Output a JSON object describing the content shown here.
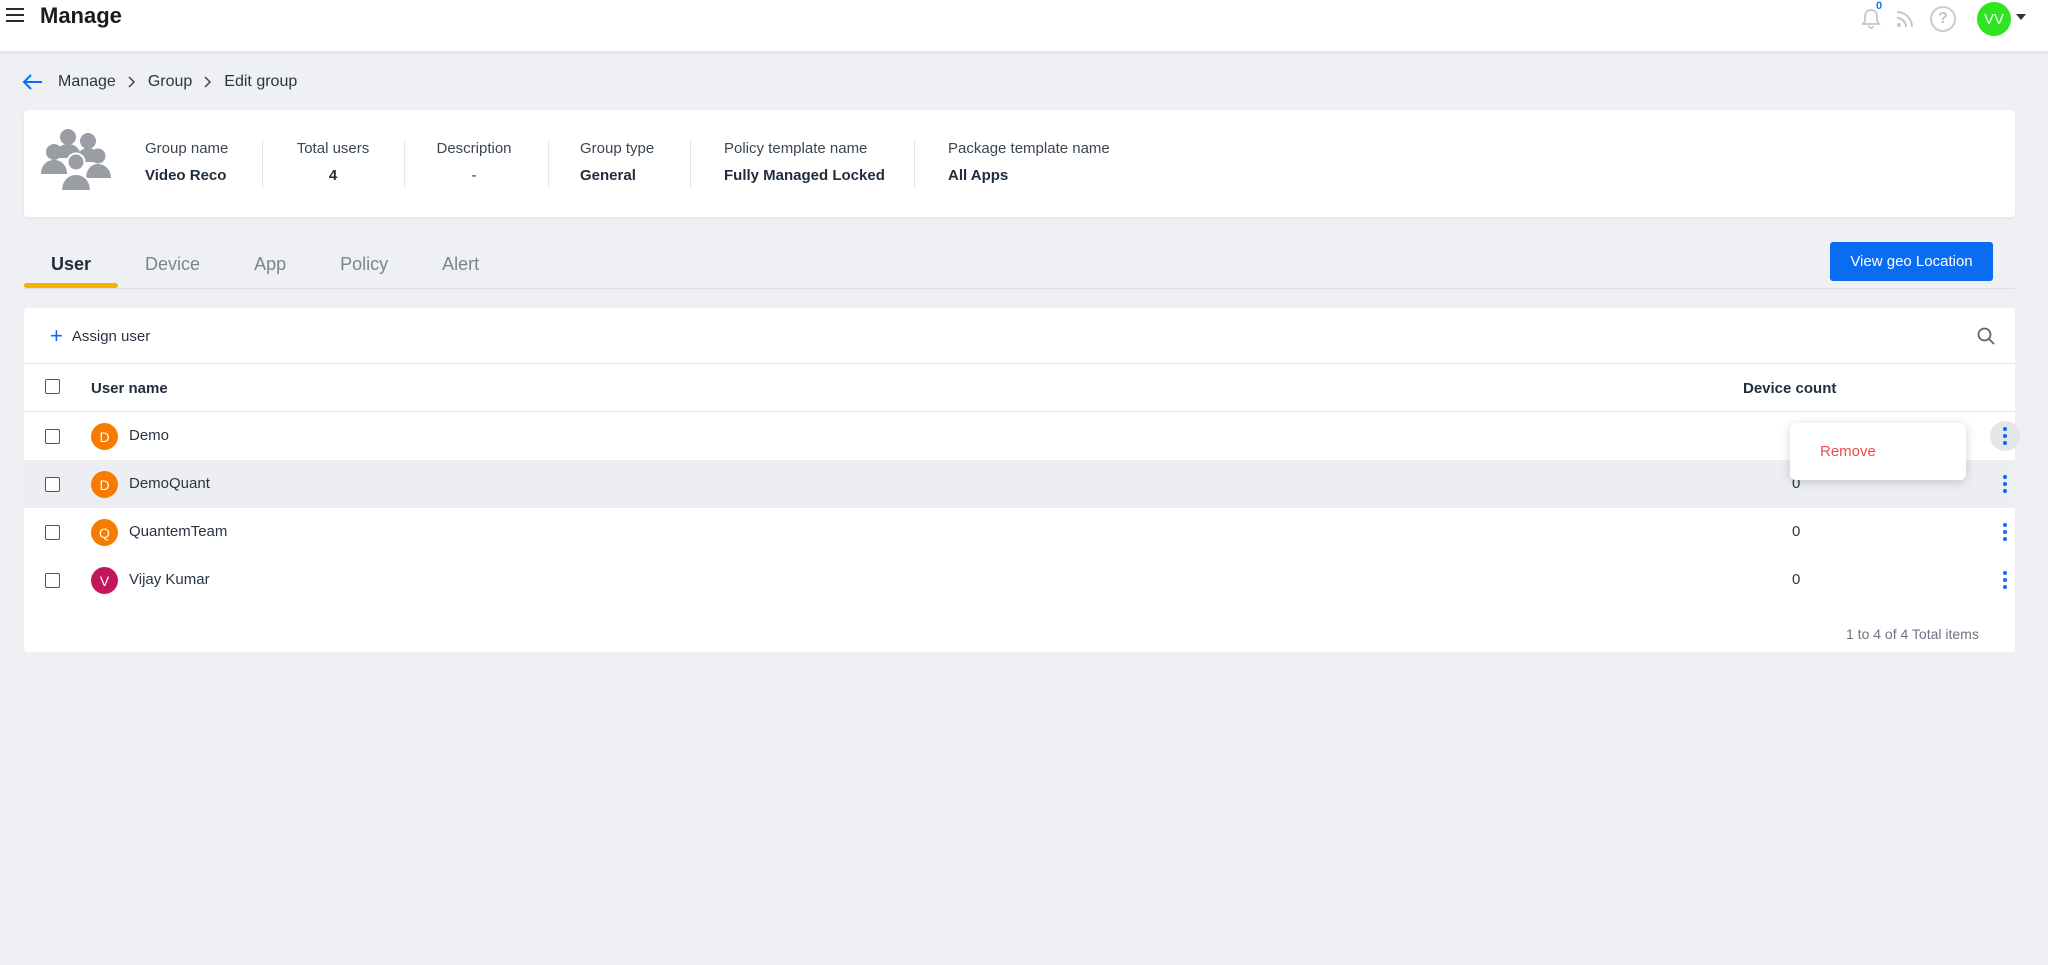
{
  "header": {
    "title": "Manage",
    "notification_count": "0",
    "help_label": "?",
    "user_initials": "VV",
    "user_avatar_color": "#2ee51f"
  },
  "breadcrumb": {
    "items": [
      "Manage",
      "Group",
      "Edit group"
    ]
  },
  "group_info": {
    "fields": [
      {
        "label": "Group name",
        "value": "Video Reco"
      },
      {
        "label": "Total users",
        "value": "4"
      },
      {
        "label": "Description",
        "value": "-"
      },
      {
        "label": "Group type",
        "value": "General"
      },
      {
        "label": "Policy template name",
        "value": "Fully Managed Locked"
      },
      {
        "label": "Package template name",
        "value": "All Apps"
      }
    ]
  },
  "tabs": [
    {
      "label": "User",
      "active": true
    },
    {
      "label": "Device",
      "active": false
    },
    {
      "label": "App",
      "active": false
    },
    {
      "label": "Policy",
      "active": false
    },
    {
      "label": "Alert",
      "active": false
    }
  ],
  "actions": {
    "geo_button": "View geo Location",
    "assign_plus": "+",
    "assign_label": "Assign user"
  },
  "table": {
    "columns": [
      "User name",
      "Device count"
    ],
    "rows": [
      {
        "initial": "D",
        "name": "Demo",
        "count": "",
        "avatar_color": "#f57c00"
      },
      {
        "initial": "D",
        "name": "DemoQuant",
        "count": "0",
        "avatar_color": "#f57c00"
      },
      {
        "initial": "Q",
        "name": "QuantemTeam",
        "count": "0",
        "avatar_color": "#f57c00"
      },
      {
        "initial": "V",
        "name": "Vijay Kumar",
        "count": "0",
        "avatar_color": "#c2185b"
      }
    ],
    "pagination": "1 to 4 of 4 Total items"
  },
  "context_menu": {
    "items": [
      "Remove"
    ]
  },
  "colors": {
    "primary": "#0a6cf3",
    "tab_indicator": "#f4b400",
    "danger": "#f04b4b"
  },
  "icons": [
    "hamburger-icon",
    "bell-icon",
    "rss-icon",
    "help-icon",
    "back-arrow-icon",
    "chevron-right-icon",
    "group-icon",
    "plus-icon",
    "search-icon",
    "kebab-menu-icon"
  ]
}
